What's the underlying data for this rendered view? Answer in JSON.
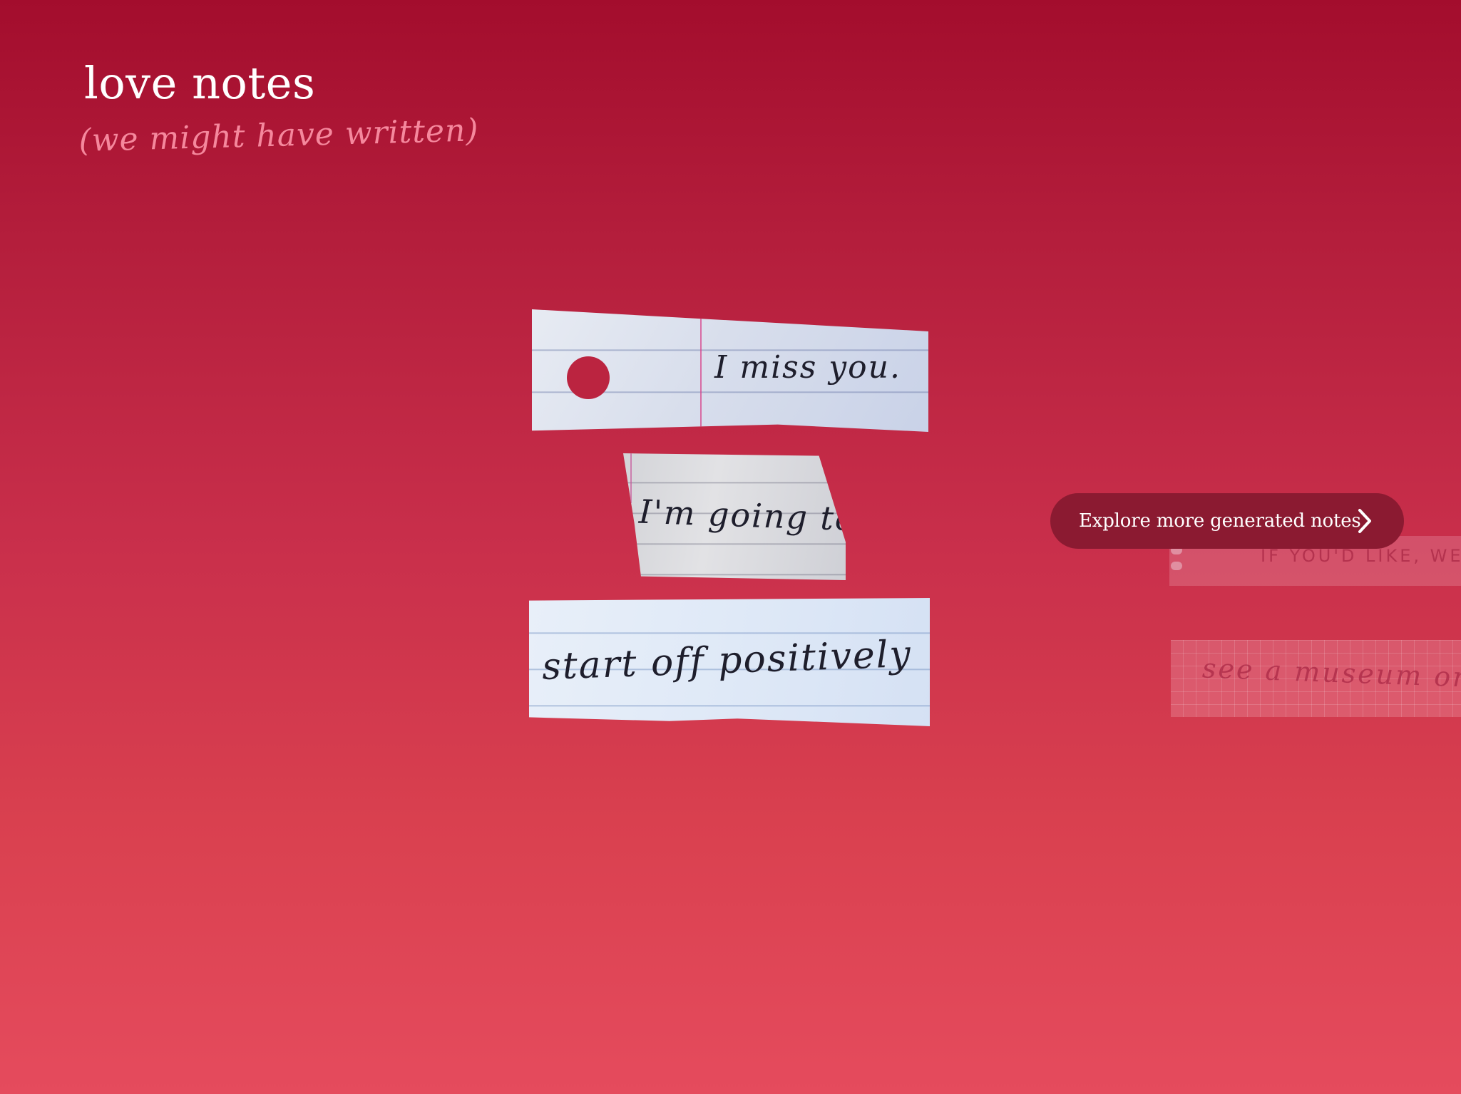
{
  "header": {
    "title": "love notes",
    "subtitle": "(we might have written)"
  },
  "notes": [
    {
      "text": "I miss you."
    },
    {
      "text": "I'm going to"
    },
    {
      "text": "start off positively"
    }
  ],
  "ghost_notes": [
    {
      "text": "IF YOU'D LIKE, WE CAN"
    },
    {
      "text": "see a museum or"
    }
  ],
  "explore_button": {
    "label": "Explore more generated notes",
    "icon": "chevron-right-icon"
  },
  "colors": {
    "background_top": "#a30d2d",
    "background_bottom": "#e54b5d",
    "button": "#8b1a31",
    "subtitle": "#f5889d"
  }
}
